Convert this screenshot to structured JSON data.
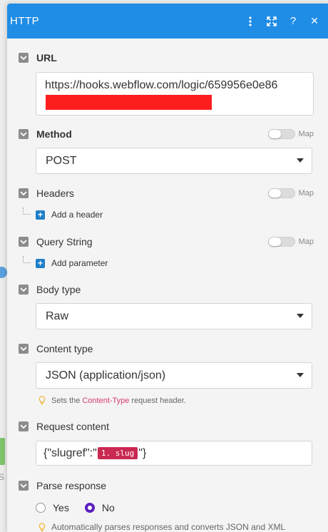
{
  "header": {
    "title": "HTTP",
    "icons": [
      "more-vertical-icon",
      "expand-icon",
      "help-icon",
      "close-icon"
    ],
    "question": "?",
    "close": "✕"
  },
  "url": {
    "label": "URL",
    "value": "https://hooks.webflow.com/logic/659956e0e86"
  },
  "method": {
    "label": "Method",
    "map_label": "Map",
    "value": "POST"
  },
  "headers": {
    "label": "Headers",
    "map_label": "Map",
    "add_label": "Add a header"
  },
  "query_string": {
    "label": "Query String",
    "map_label": "Map",
    "add_label": "Add parameter"
  },
  "body_type": {
    "label": "Body type",
    "value": "Raw"
  },
  "content_type": {
    "label": "Content type",
    "value": "JSON (application/json)",
    "hint_pre": "Sets the",
    "hint_kw": "Content-Type",
    "hint_post": "request header."
  },
  "request_content": {
    "label": "Request content",
    "prefix": "{\"slugref\":\"",
    "tag": "1. slug",
    "suffix": "\"}"
  },
  "parse_response": {
    "label": "Parse response",
    "options": [
      "Yes",
      "No"
    ],
    "selected": "No",
    "hint": "Automatically parses responses and converts JSON and XML"
  },
  "colors": {
    "header": "#1f8ce6",
    "redaction": "#ff1e1e",
    "tag": "#c92a52",
    "radio_selected": "#5a1fbf"
  },
  "left_edge": {
    "letter": "S"
  }
}
